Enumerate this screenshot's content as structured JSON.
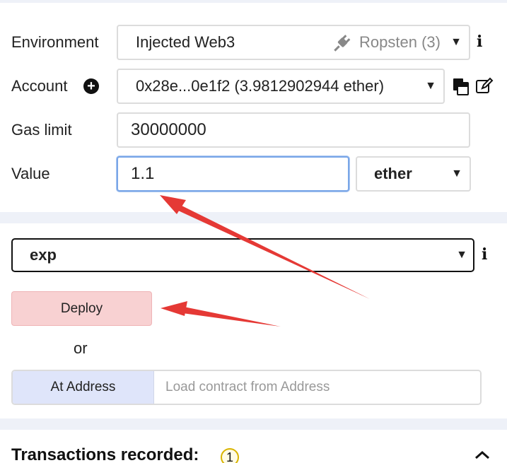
{
  "environment": {
    "label": "Environment",
    "value": "Injected Web3",
    "network": "Ropsten (3)"
  },
  "account": {
    "label": "Account",
    "value": "0x28e...0e1f2 (3.9812902944 ether)"
  },
  "gas_limit": {
    "label": "Gas limit",
    "value": "30000000"
  },
  "value": {
    "label": "Value",
    "amount": "1.1",
    "unit": "ether"
  },
  "contract": {
    "selected": "exp"
  },
  "deploy": {
    "button_label": "Deploy",
    "or_text": "or"
  },
  "at_address": {
    "button_label": "At Address",
    "placeholder": "Load contract from Address"
  },
  "transactions": {
    "title": "Transactions recorded:",
    "count": "1"
  },
  "colors": {
    "deploy_bg": "#f8d1d2",
    "at_address_bg": "#dfe5fa",
    "arrow": "#e53935",
    "focus_border": "#7aa6e8"
  }
}
